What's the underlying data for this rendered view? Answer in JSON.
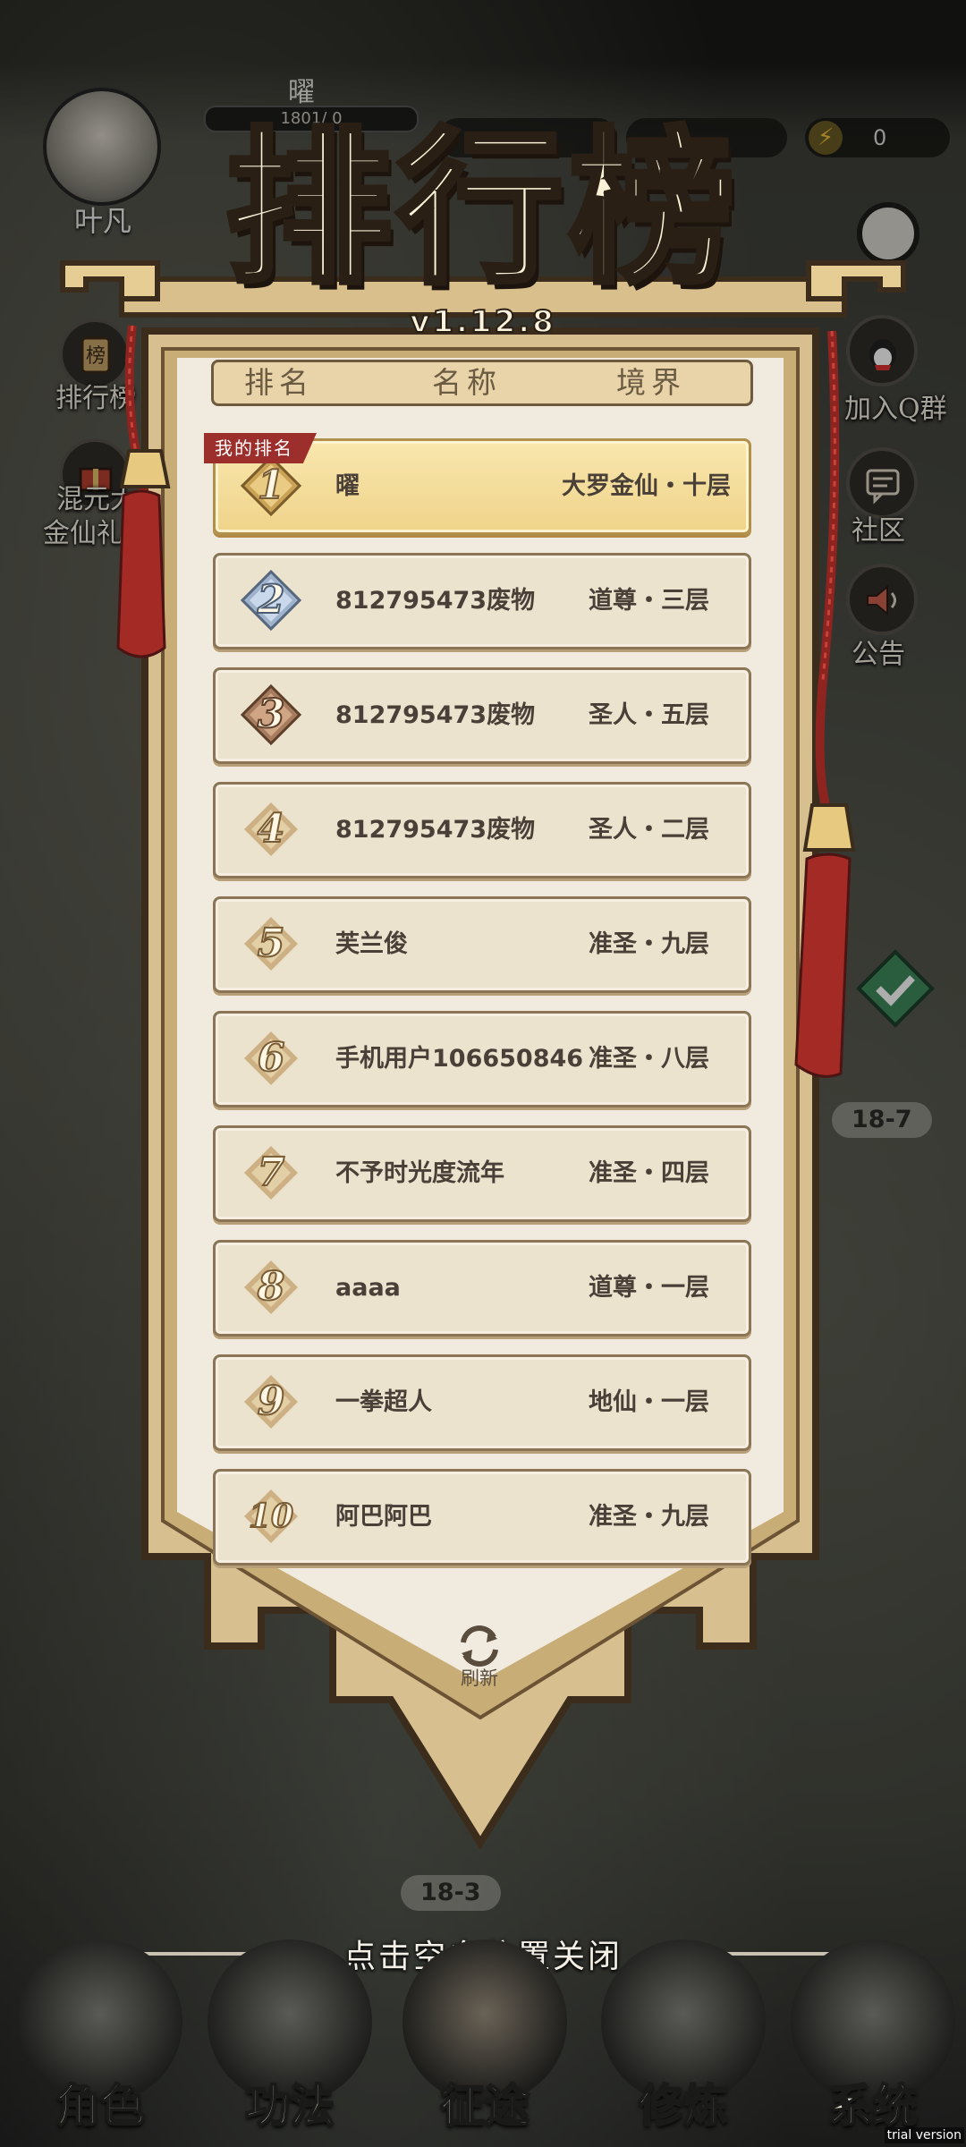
{
  "player": {
    "name": "叶凡",
    "title_char": "曜",
    "exp_text": "1801/  0"
  },
  "energy": {
    "value": "0"
  },
  "side_left": [
    {
      "label": "排行榜"
    },
    {
      "label": "混元大\n金仙礼包"
    }
  ],
  "side_right": [
    {
      "label": "加入Q群"
    },
    {
      "label": "社区"
    },
    {
      "label": "公告"
    }
  ],
  "leaderboard": {
    "title": "排行榜",
    "version": "v1.12.8",
    "columns": [
      "排名",
      "名称",
      "境界"
    ],
    "my_rank_tag": "我的排名",
    "my_entry": {
      "rank": "1",
      "name": "曜",
      "realm": "大罗金仙・十层"
    },
    "rows": [
      {
        "rank": "2",
        "name": "812795473废物",
        "realm": "道尊・三层"
      },
      {
        "rank": "3",
        "name": "812795473废物",
        "realm": "圣人・五层"
      },
      {
        "rank": "4",
        "name": "812795473废物",
        "realm": "圣人・二层"
      },
      {
        "rank": "5",
        "name": "芙兰俊",
        "realm": "准圣・九层"
      },
      {
        "rank": "6",
        "name": "手机用户106650846",
        "realm": "准圣・八层"
      },
      {
        "rank": "7",
        "name": "不予时光度流年",
        "realm": "准圣・四层"
      },
      {
        "rank": "8",
        "name": "aaaa",
        "realm": "道尊・一层"
      },
      {
        "rank": "9",
        "name": "一拳超人",
        "realm": "地仙・一层"
      },
      {
        "rank": "10",
        "name": "阿巴阿巴",
        "realm": "准圣・九层"
      }
    ],
    "refresh_label": "刷新",
    "close_hint": "点击空白位置关闭"
  },
  "stages": {
    "right": "18-7",
    "bottom": "18-3"
  },
  "nav": [
    {
      "label": "角色",
      "icon": "character-icon"
    },
    {
      "label": "功法",
      "icon": "scroll-book-icon"
    },
    {
      "label": "征途",
      "icon": "journey-icon"
    },
    {
      "label": "修炼",
      "icon": "meditate-icon"
    },
    {
      "label": "系统",
      "icon": "system-icon"
    }
  ],
  "watermark": "trial version",
  "colors": {
    "my_row": "#efd38a",
    "row": "#ece3cf",
    "banner": "#dcc59a",
    "tassel": "#a32a25",
    "tag": "#9c2f2c"
  }
}
